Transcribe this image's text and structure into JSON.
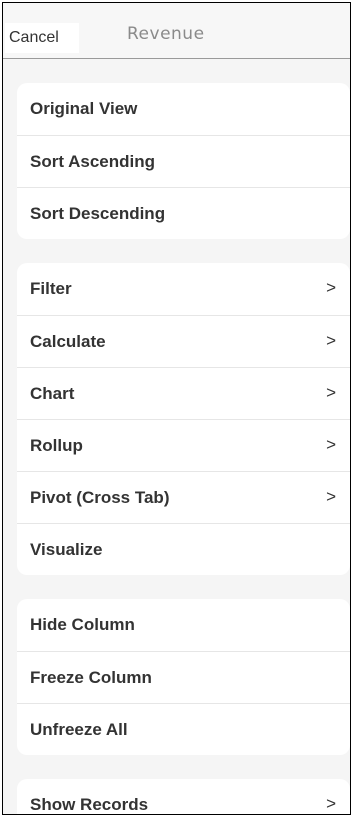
{
  "header": {
    "cancel_label": "Cancel",
    "title": "Revenue"
  },
  "groups": [
    {
      "items": [
        {
          "label": "Original View",
          "chevron": ""
        },
        {
          "label": "Sort Ascending",
          "chevron": ""
        },
        {
          "label": "Sort Descending",
          "chevron": ""
        }
      ]
    },
    {
      "items": [
        {
          "label": "Filter",
          "chevron": ">"
        },
        {
          "label": "Calculate",
          "chevron": ">"
        },
        {
          "label": "Chart",
          "chevron": ">"
        },
        {
          "label": "Rollup",
          "chevron": ">"
        },
        {
          "label": "Pivot (Cross Tab)",
          "chevron": ">"
        },
        {
          "label": "Visualize",
          "chevron": ""
        }
      ]
    },
    {
      "items": [
        {
          "label": "Hide Column",
          "chevron": ""
        },
        {
          "label": "Freeze Column",
          "chevron": ""
        },
        {
          "label": "Unfreeze All",
          "chevron": ""
        }
      ]
    },
    {
      "items": [
        {
          "label": "Show Records",
          "chevron": ">"
        }
      ]
    }
  ],
  "colors": {
    "background": "#f5f5f5",
    "card": "#ffffff",
    "text": "#333333",
    "title": "#8a8a8a",
    "divider": "#e6e6e6"
  }
}
